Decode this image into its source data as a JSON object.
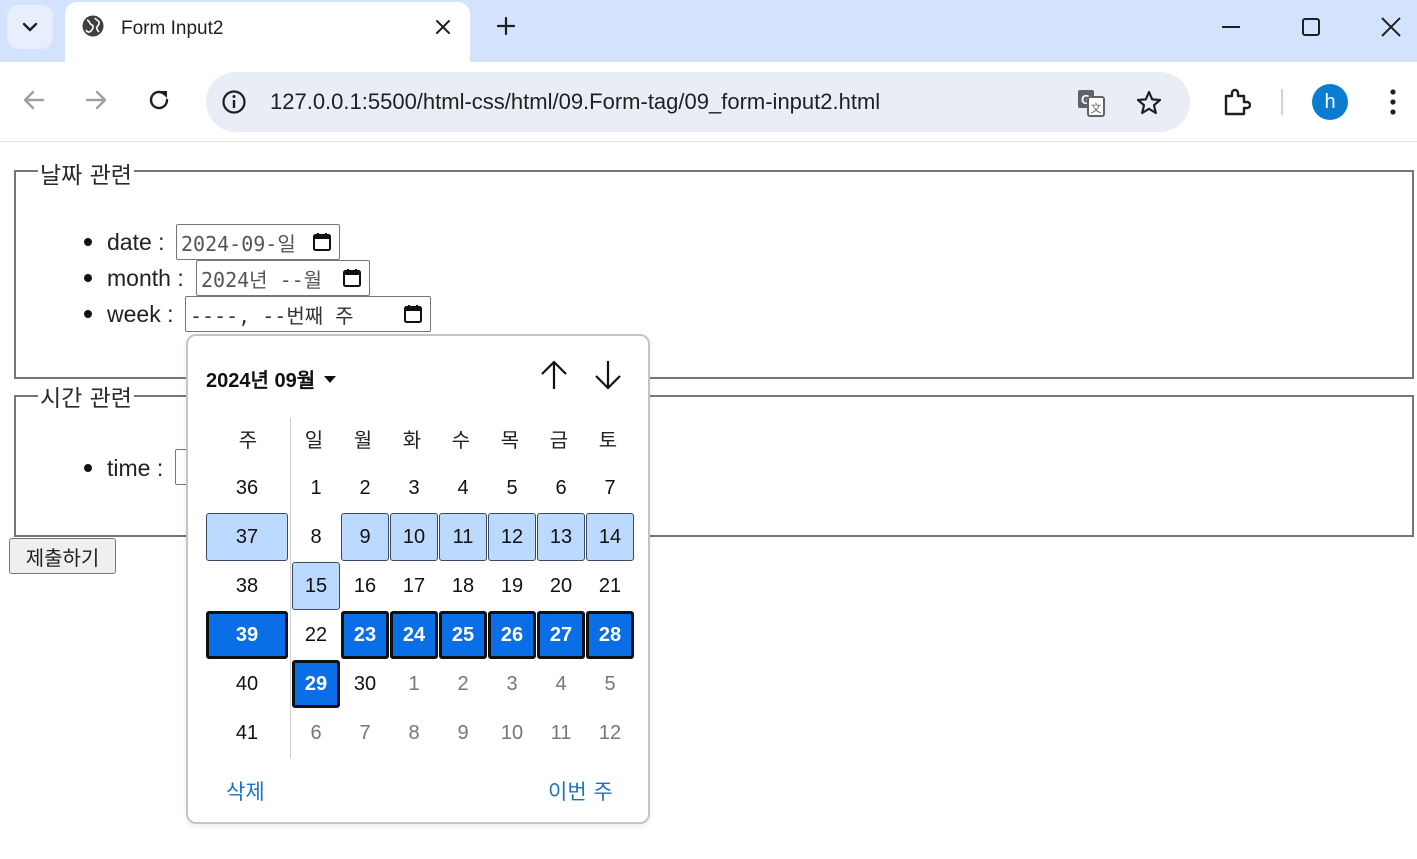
{
  "browser": {
    "tab_title": "Form Input2",
    "url": "127.0.0.1:5500/html-css/html/09.Form-tag/09_form-input2.html",
    "profile_initial": "h",
    "accent_color": "#0b7dd0"
  },
  "page": {
    "fieldset_date": {
      "legend": "날짜 관련",
      "items": [
        {
          "label": "date :",
          "value": "2024-09-일"
        },
        {
          "label": "month :",
          "value": "2024년 --월"
        },
        {
          "label": "week :",
          "value": "----, --번째 주"
        }
      ]
    },
    "fieldset_time": {
      "legend": "시간 관련",
      "items": [
        {
          "label": "time :"
        }
      ]
    },
    "submit_label": "제출하기"
  },
  "picker": {
    "month_label": "2024년 09월",
    "week_header": "주",
    "day_headers": [
      "일",
      "월",
      "화",
      "수",
      "목",
      "금",
      "토"
    ],
    "weeks": [
      {
        "week": "36",
        "days": [
          "1",
          "2",
          "3",
          "4",
          "5",
          "6",
          "7"
        ],
        "other": [
          false,
          false,
          false,
          false,
          false,
          false,
          false
        ],
        "state": "normal"
      },
      {
        "week": "37",
        "days": [
          "8",
          "9",
          "10",
          "11",
          "12",
          "13",
          "14"
        ],
        "other": [
          false,
          false,
          false,
          false,
          false,
          false,
          false
        ],
        "state": "hover"
      },
      {
        "week": "38",
        "days": [
          "15",
          "16",
          "17",
          "18",
          "19",
          "20",
          "21"
        ],
        "other": [
          false,
          false,
          false,
          false,
          false,
          false,
          false
        ],
        "state": "normal",
        "sunday_hover": true
      },
      {
        "week": "39",
        "days": [
          "22",
          "23",
          "24",
          "25",
          "26",
          "27",
          "28"
        ],
        "other": [
          false,
          false,
          false,
          false,
          false,
          false,
          false
        ],
        "state": "selected"
      },
      {
        "week": "40",
        "days": [
          "29",
          "30",
          "1",
          "2",
          "3",
          "4",
          "5"
        ],
        "other": [
          false,
          false,
          true,
          true,
          true,
          true,
          true
        ],
        "state": "normal",
        "sunday_selected": true
      },
      {
        "week": "41",
        "days": [
          "6",
          "7",
          "8",
          "9",
          "10",
          "11",
          "12"
        ],
        "other": [
          true,
          true,
          true,
          true,
          true,
          true,
          true
        ],
        "state": "normal"
      }
    ],
    "clear_label": "삭제",
    "this_week_label": "이번 주",
    "selected_color": "#0a6fe6",
    "hover_color": "#bcdaff",
    "link_color": "#1a73c8"
  }
}
